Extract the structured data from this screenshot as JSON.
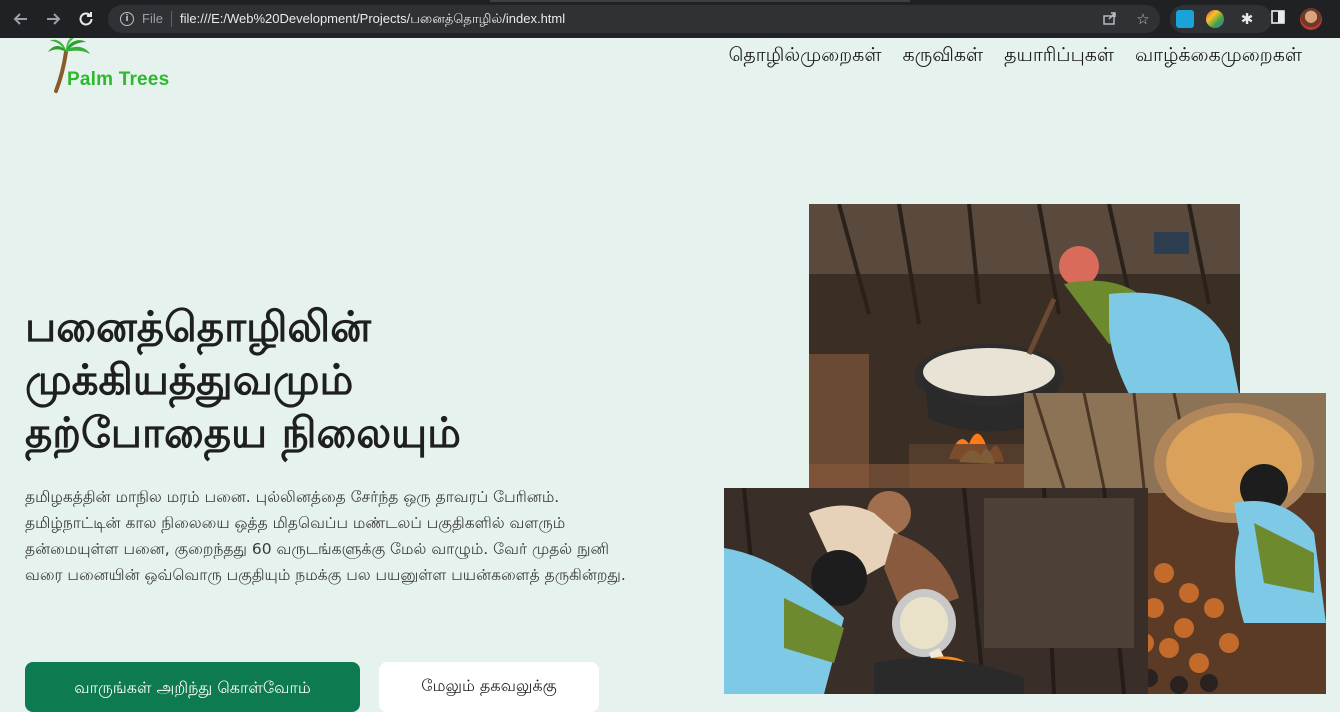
{
  "browser": {
    "file_label": "File",
    "url": "file:///E:/Web%20Development/Projects/பனைத்தொழில்/index.html",
    "icons": [
      "back-icon",
      "forward-icon",
      "reload-icon",
      "info-icon",
      "share-icon",
      "star-icon",
      "extension-icon",
      "puzzle-icon",
      "sidepanel-icon",
      "avatar"
    ]
  },
  "header": {
    "logo_text": "Palm Trees",
    "nav": [
      {
        "label": "தொழில்முறைகள்"
      },
      {
        "label": "கருவிகள்"
      },
      {
        "label": "தயாரிப்புகள்"
      },
      {
        "label": "வாழ்க்கைமுறைகள்"
      }
    ]
  },
  "hero": {
    "title_lines": [
      "பனைத்தொழிலின்",
      "முக்கியத்துவமும்",
      "தற்போதைய நிலையும்"
    ],
    "description": "தமிழகத்தின் மாநில மரம் பனை. புல்லினத்தை சேர்ந்த ஒரு தாவரப் பேரினம். தமிழ்நாட்டின் கால நிலையை ஒத்த மிதவெப்ப மண்டலப் பகுதிகளில் வளரும் தன்மையுள்ள பனை, குறைந்தது 60 வருடங்களுக்கு மேல் வாழும். வேர் முதல் நுனி வரை பனையின் ஒவ்வொரு பகுதியும் நமக்கு பல பயனுள்ள பயன்களைத் தருகின்றது.",
    "primary_button": "வாருங்கள் அறிந்து கொள்வோம்",
    "secondary_button": "மேலும் தகவலுக்கு"
  },
  "colors": {
    "page_bg": "#e5f2ee",
    "primary": "#0e7a4f",
    "logo_green": "#2eb82e"
  }
}
